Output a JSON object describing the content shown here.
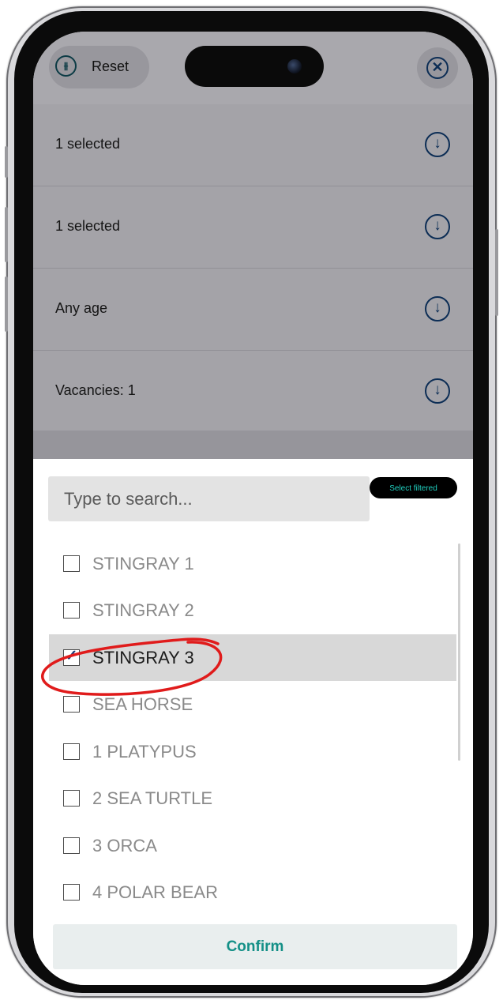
{
  "header": {
    "reset_label": "Reset",
    "reset_icon": "sliders-icon",
    "close_icon": "close-circle-icon"
  },
  "filters": [
    {
      "text": "1 selected",
      "icon": "chevron-down-circle-icon"
    },
    {
      "text": "1 selected",
      "icon": "chevron-down-circle-icon"
    },
    {
      "text": "Any age",
      "icon": "chevron-down-circle-icon"
    },
    {
      "text": "Vacancies: 1",
      "icon": "chevron-down-circle-icon"
    }
  ],
  "sheet": {
    "search_placeholder": "Type to search...",
    "select_filtered_label": "Select filtered",
    "items": [
      {
        "label": "STINGRAY 1",
        "checked": false
      },
      {
        "label": "STINGRAY 2",
        "checked": false
      },
      {
        "label": "STINGRAY 3",
        "checked": true
      },
      {
        "label": "SEA HORSE",
        "checked": false
      },
      {
        "label": "1 PLATYPUS",
        "checked": false
      },
      {
        "label": "2 SEA TURTLE",
        "checked": false
      },
      {
        "label": "3 ORCA",
        "checked": false
      },
      {
        "label": "4 POLAR BEAR",
        "checked": false
      }
    ],
    "confirm_label": "Confirm"
  },
  "colors": {
    "accent": "#149087",
    "dim_overlay": "#a4a3a8",
    "annotation": "#e01b1b"
  }
}
